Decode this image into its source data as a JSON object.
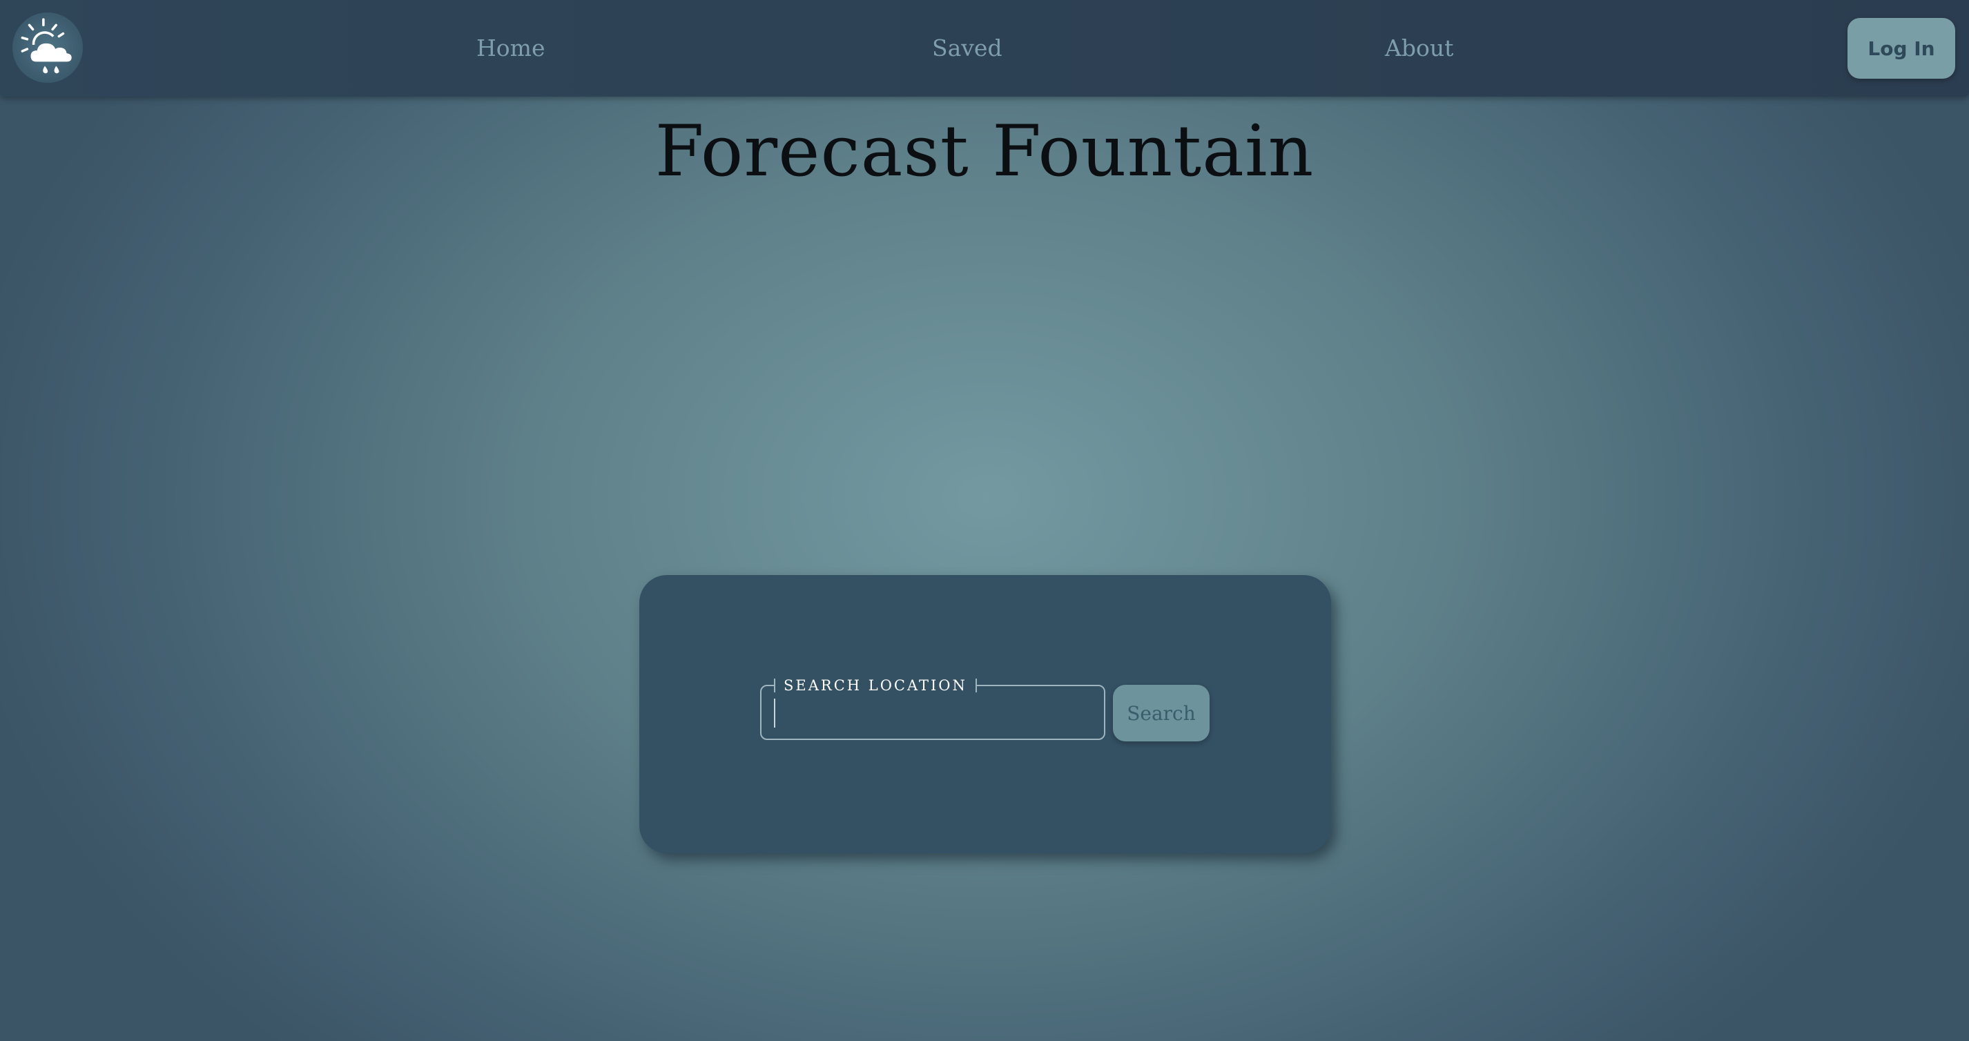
{
  "nav": {
    "logo_icon": "weather-sun-cloud-rain-icon",
    "links": [
      "Home",
      "Saved",
      "About"
    ],
    "login_label": "Log In"
  },
  "page": {
    "title": "Forecast Fountain"
  },
  "search": {
    "legend": "SEARCH LOCATION",
    "value": "",
    "button_label": "Search"
  },
  "colors": {
    "navbar": "#2f4558",
    "card": "#345063",
    "button": "#7a9ea6",
    "link": "#7f9eab"
  }
}
